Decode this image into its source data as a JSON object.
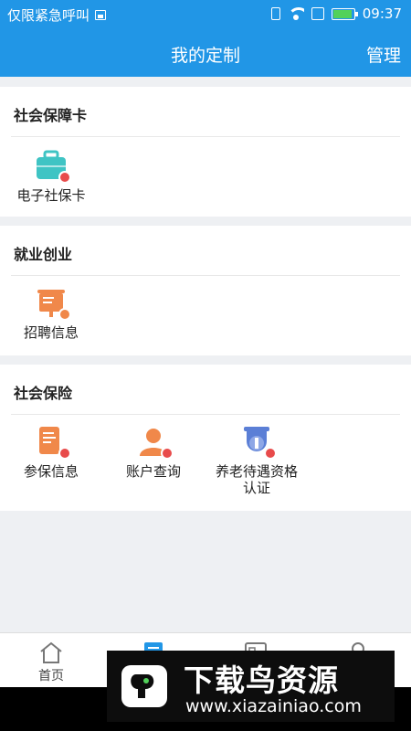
{
  "status_bar": {
    "left_text": "仅限紧急呼叫",
    "time": "09:37",
    "battery_level": 0.95
  },
  "header": {
    "title": "我的定制",
    "manage_label": "管理"
  },
  "sections": [
    {
      "title": "社会保障卡",
      "items": [
        {
          "label": "电子社保卡",
          "icon": "ecard-icon"
        }
      ]
    },
    {
      "title": "就业创业",
      "items": [
        {
          "label": "招聘信息",
          "icon": "recruitment-icon"
        }
      ]
    },
    {
      "title": "社会保险",
      "items": [
        {
          "label": "参保信息",
          "icon": "insurance-info-icon"
        },
        {
          "label": "账户查询",
          "icon": "account-query-icon"
        },
        {
          "label": "养老待遇资格认证",
          "icon": "pension-certification-icon"
        }
      ]
    }
  ],
  "tabs": [
    {
      "label": "首页",
      "icon": "home-icon"
    },
    {
      "label": "",
      "icon": "my-custom-icon",
      "active": true
    },
    {
      "label": "",
      "icon": "news-icon"
    },
    {
      "label": "",
      "icon": "profile-icon"
    }
  ],
  "watermark": {
    "title": "下载鸟资源",
    "url": "www.xiazainiao.com"
  },
  "colors": {
    "primary": "#2196e6",
    "teal": "#3fc4c4",
    "orange": "#f0884a",
    "badge": "#e84b4b"
  }
}
